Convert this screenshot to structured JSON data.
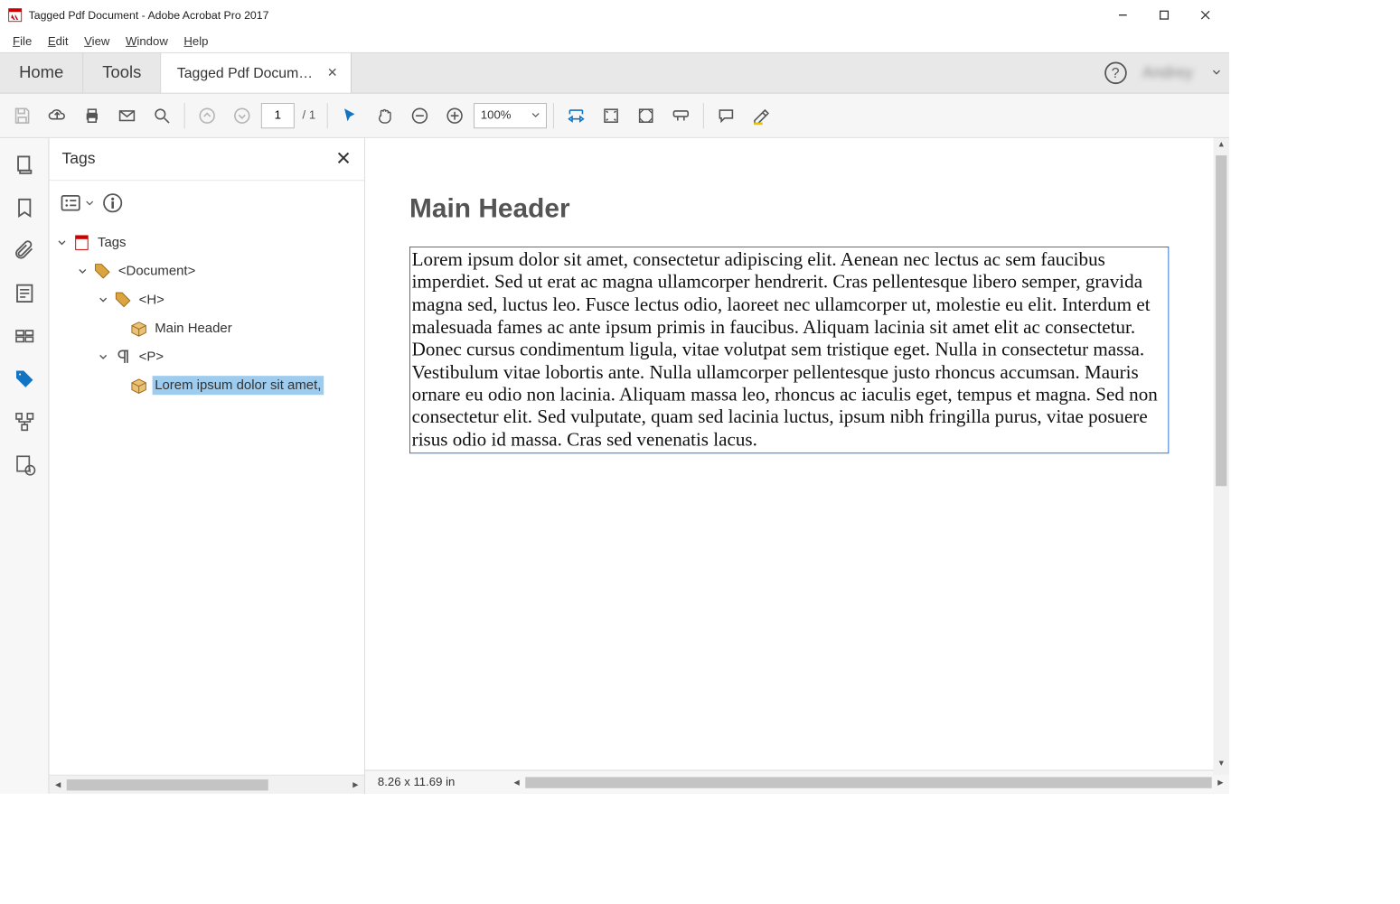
{
  "window": {
    "title": "Tagged Pdf Document - Adobe Acrobat Pro 2017"
  },
  "menu": {
    "file": "File",
    "edit": "Edit",
    "view": "View",
    "window": "Window",
    "help": "Help"
  },
  "tabs": {
    "home": "Home",
    "tools": "Tools",
    "doc_label": "Tagged Pdf Docum…",
    "user": "Andrey"
  },
  "toolbar": {
    "page_current": "1",
    "page_total": "/ 1",
    "zoom": "100%"
  },
  "tags_panel": {
    "title": "Tags",
    "root": "Tags",
    "document": "<Document>",
    "h": "<H>",
    "h_content": "Main Header",
    "p": "<P>",
    "p_content": "Lorem ipsum dolor sit amet,"
  },
  "document": {
    "header": "Main Header",
    "body": "Lorem ipsum dolor sit amet, consectetur adipiscing elit. Aenean nec lectus ac sem faucibus imperdiet. Sed ut erat ac magna ullamcorper hendrerit. Cras pellentesque libero semper, gravida magna sed, luctus leo. Fusce lectus odio, laoreet nec ullamcorper ut, molestie eu elit. Interdum et malesuada fames ac ante ipsum primis in faucibus. Aliquam lacinia sit amet elit ac consectetur. Donec cursus condimentum ligula, vitae volutpat sem tristique eget. Nulla in consectetur massa. Vestibulum vitae lobortis ante. Nulla ullamcorper pellentesque justo rhoncus accumsan. Mauris ornare eu odio non lacinia. Aliquam massa leo, rhoncus ac iaculis eget, tempus et magna. Sed non consectetur elit. Sed vulputate, quam sed lacinia luctus, ipsum nibh fringilla purus, vitae posuere risus odio id massa. Cras sed venenatis lacus."
  },
  "status": {
    "page_size": "8.26 x 11.69 in"
  }
}
